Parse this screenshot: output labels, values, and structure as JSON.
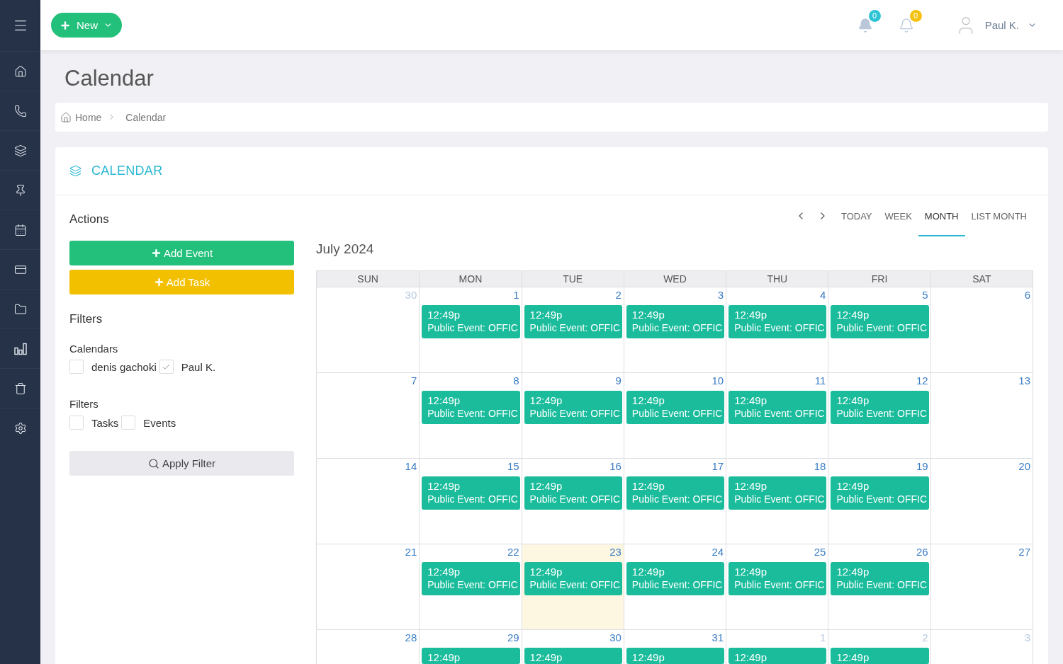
{
  "topbar": {
    "new_button": {
      "label": "New"
    },
    "notifications": [
      {
        "count": "0",
        "color": "#2ec4d6"
      },
      {
        "count": "0",
        "color": "#f4c20d"
      }
    ],
    "user": {
      "name": "Paul K."
    }
  },
  "page_title": "Calendar",
  "breadcrumb": [
    {
      "label": "Home"
    },
    {
      "label": "Calendar"
    }
  ],
  "card_title": "CALENDAR",
  "actions": {
    "heading": "Actions",
    "buttons": [
      {
        "label": "Add Event",
        "kind": "event"
      },
      {
        "label": "Add Task",
        "kind": "task"
      }
    ]
  },
  "filters": {
    "heading": "Filters",
    "groups": [
      {
        "label": "Calendars",
        "options": [
          {
            "label": "denis gachoki",
            "checked": false
          },
          {
            "label": "Paul K.",
            "checked": true
          }
        ]
      },
      {
        "label": "Filters",
        "options": [
          {
            "label": "Tasks",
            "checked": false
          },
          {
            "label": "Events",
            "checked": false
          }
        ]
      }
    ],
    "apply_button": {
      "label": "Apply Filter"
    }
  },
  "toolbar": {
    "today": {
      "label": "TODAY"
    },
    "views": [
      {
        "label": "WEEK",
        "selected": false
      },
      {
        "label": "MONTH",
        "selected": true
      },
      {
        "label": "LIST MONTH",
        "selected": false
      }
    ]
  },
  "calendar": {
    "title": "July 2024",
    "weekdays": [
      "SUN",
      "MON",
      "TUE",
      "WED",
      "THU",
      "FRI",
      "SAT"
    ],
    "weeks": [
      {
        "days": [
          {
            "number": "30",
            "other_month": true,
            "today": false
          },
          {
            "number": "1",
            "other_month": false,
            "today": false,
            "events": [
              {
                "time": "12:49p",
                "title": "Public Event: OFFIC"
              }
            ]
          },
          {
            "number": "2",
            "other_month": false,
            "today": false,
            "events": [
              {
                "time": "12:49p",
                "title": "Public Event: OFFIC"
              }
            ]
          },
          {
            "number": "3",
            "other_month": false,
            "today": false,
            "events": [
              {
                "time": "12:49p",
                "title": "Public Event: OFFIC"
              }
            ]
          },
          {
            "number": "4",
            "other_month": false,
            "today": false,
            "events": [
              {
                "time": "12:49p",
                "title": "Public Event: OFFIC"
              }
            ]
          },
          {
            "number": "5",
            "other_month": false,
            "today": false,
            "events": [
              {
                "time": "12:49p",
                "title": "Public Event: OFFIC"
              }
            ]
          },
          {
            "number": "6",
            "other_month": false,
            "today": false
          }
        ]
      },
      {
        "days": [
          {
            "number": "7",
            "other_month": false,
            "today": false
          },
          {
            "number": "8",
            "other_month": false,
            "today": false,
            "events": [
              {
                "time": "12:49p",
                "title": "Public Event: OFFIC"
              }
            ]
          },
          {
            "number": "9",
            "other_month": false,
            "today": false,
            "events": [
              {
                "time": "12:49p",
                "title": "Public Event: OFFIC"
              }
            ]
          },
          {
            "number": "10",
            "other_month": false,
            "today": false,
            "events": [
              {
                "time": "12:49p",
                "title": "Public Event: OFFIC"
              }
            ]
          },
          {
            "number": "11",
            "other_month": false,
            "today": false,
            "events": [
              {
                "time": "12:49p",
                "title": "Public Event: OFFIC"
              }
            ]
          },
          {
            "number": "12",
            "other_month": false,
            "today": false,
            "events": [
              {
                "time": "12:49p",
                "title": "Public Event: OFFIC"
              }
            ]
          },
          {
            "number": "13",
            "other_month": false,
            "today": false
          }
        ]
      },
      {
        "days": [
          {
            "number": "14",
            "other_month": false,
            "today": false
          },
          {
            "number": "15",
            "other_month": false,
            "today": false,
            "events": [
              {
                "time": "12:49p",
                "title": "Public Event: OFFIC"
              }
            ]
          },
          {
            "number": "16",
            "other_month": false,
            "today": false,
            "events": [
              {
                "time": "12:49p",
                "title": "Public Event: OFFIC"
              }
            ]
          },
          {
            "number": "17",
            "other_month": false,
            "today": false,
            "events": [
              {
                "time": "12:49p",
                "title": "Public Event: OFFIC"
              }
            ]
          },
          {
            "number": "18",
            "other_month": false,
            "today": false,
            "events": [
              {
                "time": "12:49p",
                "title": "Public Event: OFFIC"
              }
            ]
          },
          {
            "number": "19",
            "other_month": false,
            "today": false,
            "events": [
              {
                "time": "12:49p",
                "title": "Public Event: OFFIC"
              }
            ]
          },
          {
            "number": "20",
            "other_month": false,
            "today": false
          }
        ]
      },
      {
        "days": [
          {
            "number": "21",
            "other_month": false,
            "today": false
          },
          {
            "number": "22",
            "other_month": false,
            "today": false,
            "events": [
              {
                "time": "12:49p",
                "title": "Public Event: OFFIC"
              }
            ]
          },
          {
            "number": "23",
            "other_month": false,
            "today": true,
            "events": [
              {
                "time": "12:49p",
                "title": "Public Event: OFFIC"
              }
            ]
          },
          {
            "number": "24",
            "other_month": false,
            "today": false,
            "events": [
              {
                "time": "12:49p",
                "title": "Public Event: OFFIC"
              }
            ]
          },
          {
            "number": "25",
            "other_month": false,
            "today": false,
            "events": [
              {
                "time": "12:49p",
                "title": "Public Event: OFFIC"
              }
            ]
          },
          {
            "number": "26",
            "other_month": false,
            "today": false,
            "events": [
              {
                "time": "12:49p",
                "title": "Public Event: OFFIC"
              }
            ]
          },
          {
            "number": "27",
            "other_month": false,
            "today": false
          }
        ]
      },
      {
        "days": [
          {
            "number": "28",
            "other_month": false,
            "today": false
          },
          {
            "number": "29",
            "other_month": false,
            "today": false,
            "events": [
              {
                "time": "12:49p"
              }
            ]
          },
          {
            "number": "30",
            "other_month": false,
            "today": false,
            "events": [
              {
                "time": "12:49p"
              }
            ]
          },
          {
            "number": "31",
            "other_month": false,
            "today": false,
            "events": [
              {
                "time": "12:49p"
              }
            ]
          },
          {
            "number": "1",
            "other_month": true,
            "today": false,
            "events": [
              {
                "time": "12:49p"
              }
            ]
          },
          {
            "number": "2",
            "other_month": true,
            "today": false,
            "events": [
              {
                "time": "12:49p"
              }
            ]
          },
          {
            "number": "3",
            "other_month": true,
            "today": false
          }
        ]
      }
    ]
  }
}
